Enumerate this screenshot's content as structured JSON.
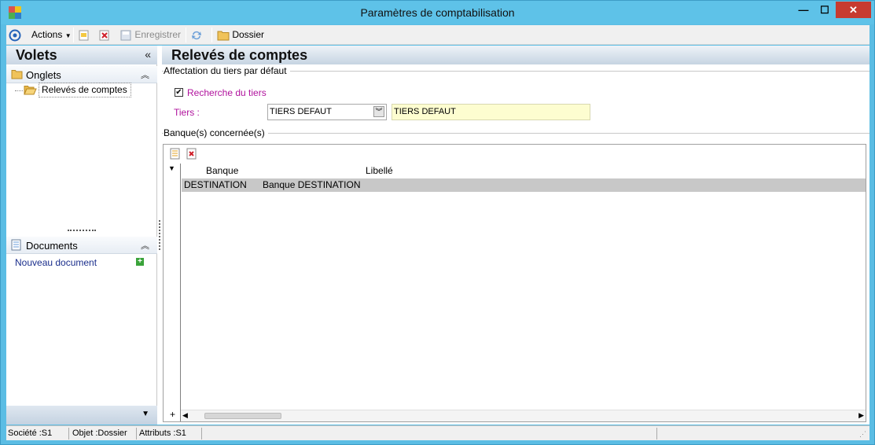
{
  "window": {
    "title": "Paramètres de comptabilisation",
    "minimize_glyph": "—",
    "maximize_glyph": "☐",
    "close_glyph": "✕"
  },
  "toolbar": {
    "actions_label": "Actions",
    "save_label": "Enregistrer",
    "folder_label": "Dossier"
  },
  "left": {
    "title": "Volets",
    "collapse_glyph": "«",
    "onglets_label": "Onglets",
    "tree_item_label": "Relevés de comptes",
    "documents_label": "Documents",
    "new_document_label": "Nouveau document"
  },
  "right": {
    "title": "Relevés de comptes",
    "group_affectation": "Affectation du tiers par défaut",
    "checkbox_label": "Recherche du tiers",
    "checkbox_checked": true,
    "tiers_label": "Tiers :",
    "tiers_select_value": "TIERS DEFAUT",
    "tiers_text_value": "TIERS DEFAUT",
    "group_banques": "Banque(s) concernée(s)",
    "grid": {
      "columns": [
        "Banque",
        "Libellé"
      ],
      "rows": [
        [
          "DESTINATION",
          "Banque DESTINATION"
        ]
      ]
    }
  },
  "status": {
    "societe": "Société :S1",
    "objet": "Objet :Dossier",
    "attributs": "Attributs :S1"
  },
  "colors": {
    "titlebar": "#5ec2e8",
    "close_button": "#c73b30",
    "accent_label": "#b0129d",
    "link": "#1a2e8c",
    "selected_row": "#c8c8c8"
  }
}
